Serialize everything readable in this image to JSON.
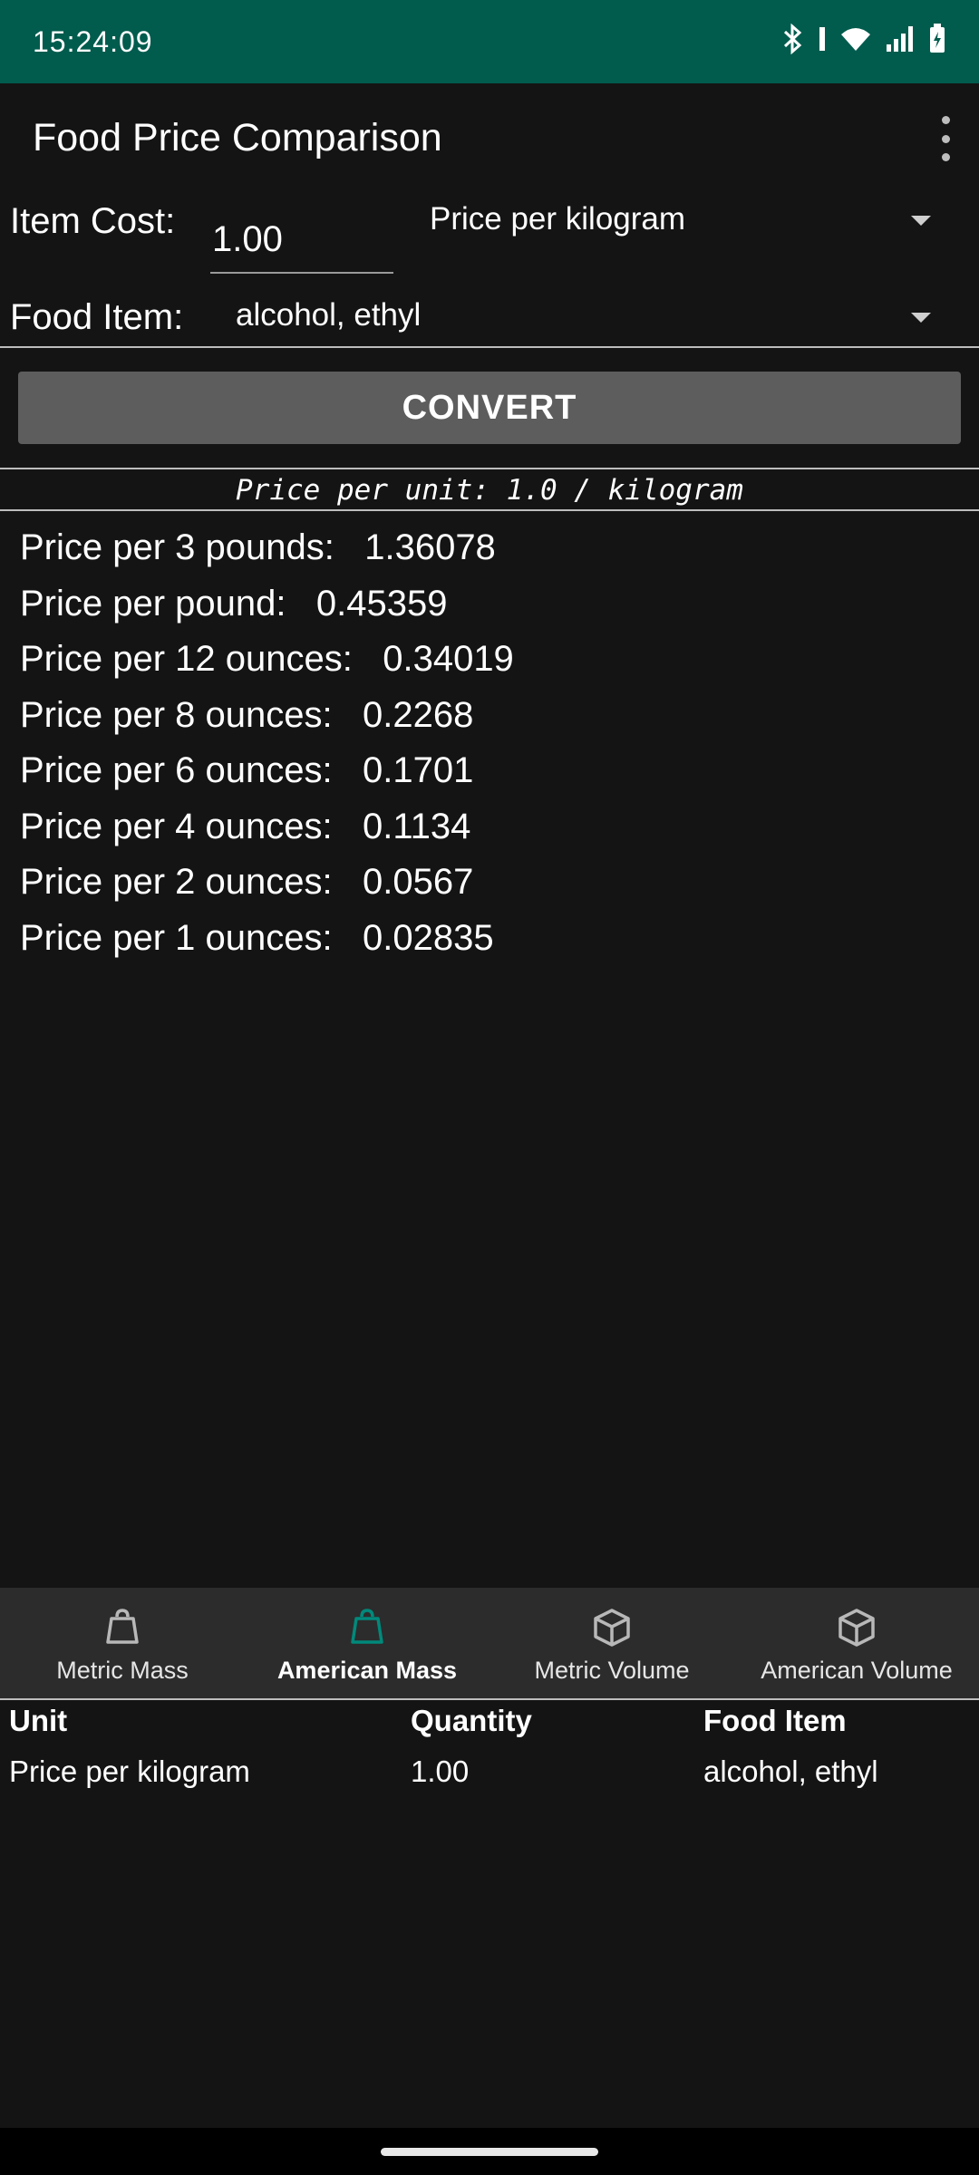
{
  "status": {
    "time": "15:24:09"
  },
  "app": {
    "title": "Food Price Comparison"
  },
  "form": {
    "cost_label": "Item Cost:",
    "cost_value": "1.00",
    "unit_selected": "Price per kilogram",
    "food_label": "Food Item:",
    "food_selected": "alcohol, ethyl",
    "convert_label": "CONVERT"
  },
  "unit_price": "Price per unit: 1.0 / kilogram",
  "results": [
    "Price per 3 pounds:   1.36078",
    "Price per pound:   0.45359",
    "Price per 12 ounces:   0.34019",
    "Price per 8 ounces:   0.2268",
    "Price per 6 ounces:   0.1701",
    "Price per 4 ounces:   0.1134",
    "Price per 2 ounces:   0.0567",
    "Price per 1 ounces:   0.02835"
  ],
  "nav": [
    {
      "label": "Metric Mass",
      "icon": "weight-icon",
      "active": false
    },
    {
      "label": "American Mass",
      "icon": "weight-icon",
      "active": true
    },
    {
      "label": "Metric Volume",
      "icon": "cube-icon",
      "active": false
    },
    {
      "label": "American Volume",
      "icon": "cube-icon",
      "active": false
    }
  ],
  "table": {
    "headers": [
      "Unit",
      "Quantity",
      "Food Item"
    ],
    "rows": [
      [
        "Price per kilogram",
        "1.00",
        "alcohol, ethyl"
      ]
    ]
  },
  "colors": {
    "status_bar": "#015c4e",
    "accent": "#00897b",
    "background": "#141414"
  }
}
